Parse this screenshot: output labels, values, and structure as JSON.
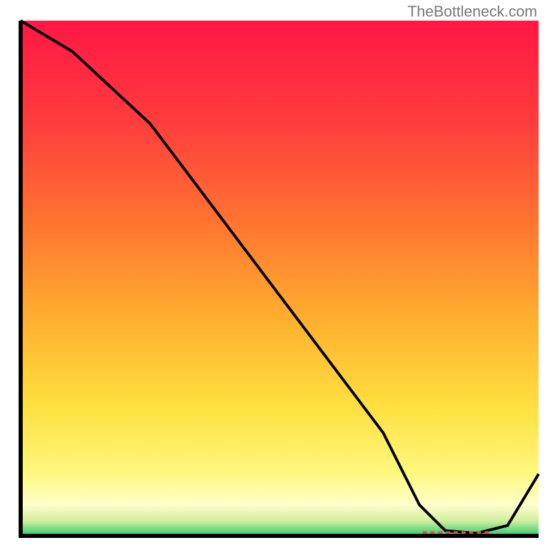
{
  "watermark": "TheBottleneck.com",
  "chart_data": {
    "type": "line",
    "title": "",
    "xlabel": "",
    "ylabel": "",
    "xlim": [
      0,
      100
    ],
    "ylim": [
      0,
      100
    ],
    "x": [
      0,
      10,
      25,
      40,
      55,
      70,
      77,
      82,
      88,
      94,
      100
    ],
    "y": [
      100,
      94,
      80,
      60,
      40,
      20,
      6,
      1,
      0.5,
      2,
      12
    ],
    "gradient_stops": [
      {
        "offset": 0,
        "color": "#ff1744"
      },
      {
        "offset": 20,
        "color": "#ff3d3d"
      },
      {
        "offset": 40,
        "color": "#ff7730"
      },
      {
        "offset": 60,
        "color": "#ffb530"
      },
      {
        "offset": 75,
        "color": "#ffe040"
      },
      {
        "offset": 88,
        "color": "#fff880"
      },
      {
        "offset": 94,
        "color": "#ffffcc"
      },
      {
        "offset": 97,
        "color": "#d4f0a0"
      },
      {
        "offset": 100,
        "color": "#2ecc71"
      }
    ],
    "marker": {
      "x_start": 78,
      "x_end": 90,
      "y": 0.5,
      "color": "#e74c3c"
    }
  }
}
